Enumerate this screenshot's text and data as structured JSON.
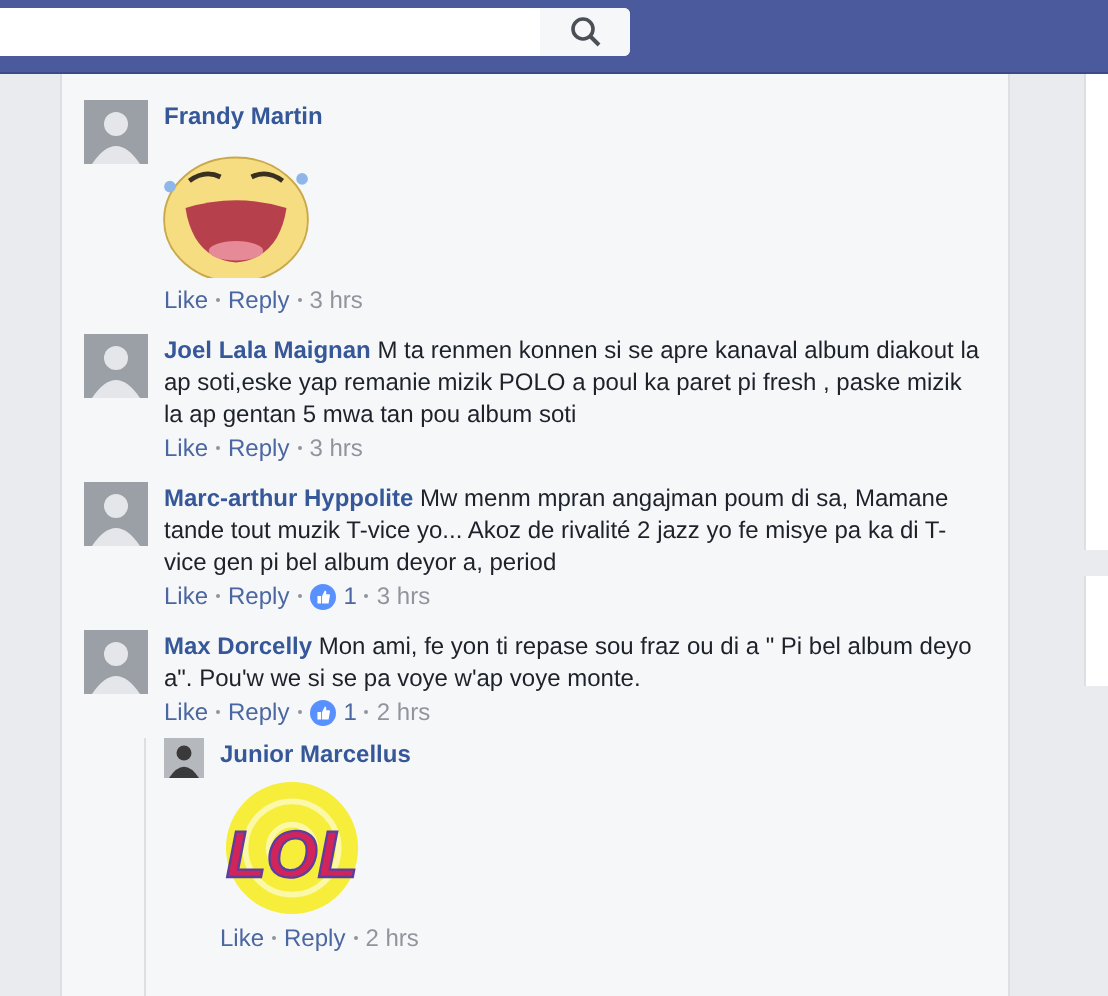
{
  "comments": [
    {
      "name": "Frandy Martin",
      "sticker": {
        "kind": "laughing-face"
      },
      "like": "Like",
      "reply": "Reply",
      "time": "3 hrs"
    },
    {
      "name": "Joel Lala Maignan",
      "text": "M ta renmen konnen si se apre kanaval album diakout la ap soti,eske yap remanie mizik POLO a poul ka paret pi fresh , paske mizik la ap gentan 5 mwa tan pou album soti",
      "like": "Like",
      "reply": "Reply",
      "time": "3 hrs"
    },
    {
      "name": "Marc-arthur Hyppolite",
      "text": "Mw menm mpran angajman poum di sa, Mamane tande tout muzik T-vice yo... Akoz de rivalité 2 jazz yo fe misye pa ka di T-vice gen pi bel album deyor a, period",
      "like": "Like",
      "reply": "Reply",
      "likes": "1",
      "time": "3 hrs"
    },
    {
      "name": "Max Dorcelly",
      "text": "Mon ami, fe yon ti repase sou fraz ou di a \" Pi bel album deyo a\". Pou'w we si se pa voye w'ap voye monte.",
      "like": "Like",
      "reply": "Reply",
      "likes": "1",
      "time": "2 hrs",
      "replies": [
        {
          "name": "Junior Marcellus",
          "sticker": {
            "kind": "lol",
            "text": "LOL"
          },
          "like": "Like",
          "reply": "Reply",
          "time": "2 hrs"
        }
      ]
    }
  ]
}
